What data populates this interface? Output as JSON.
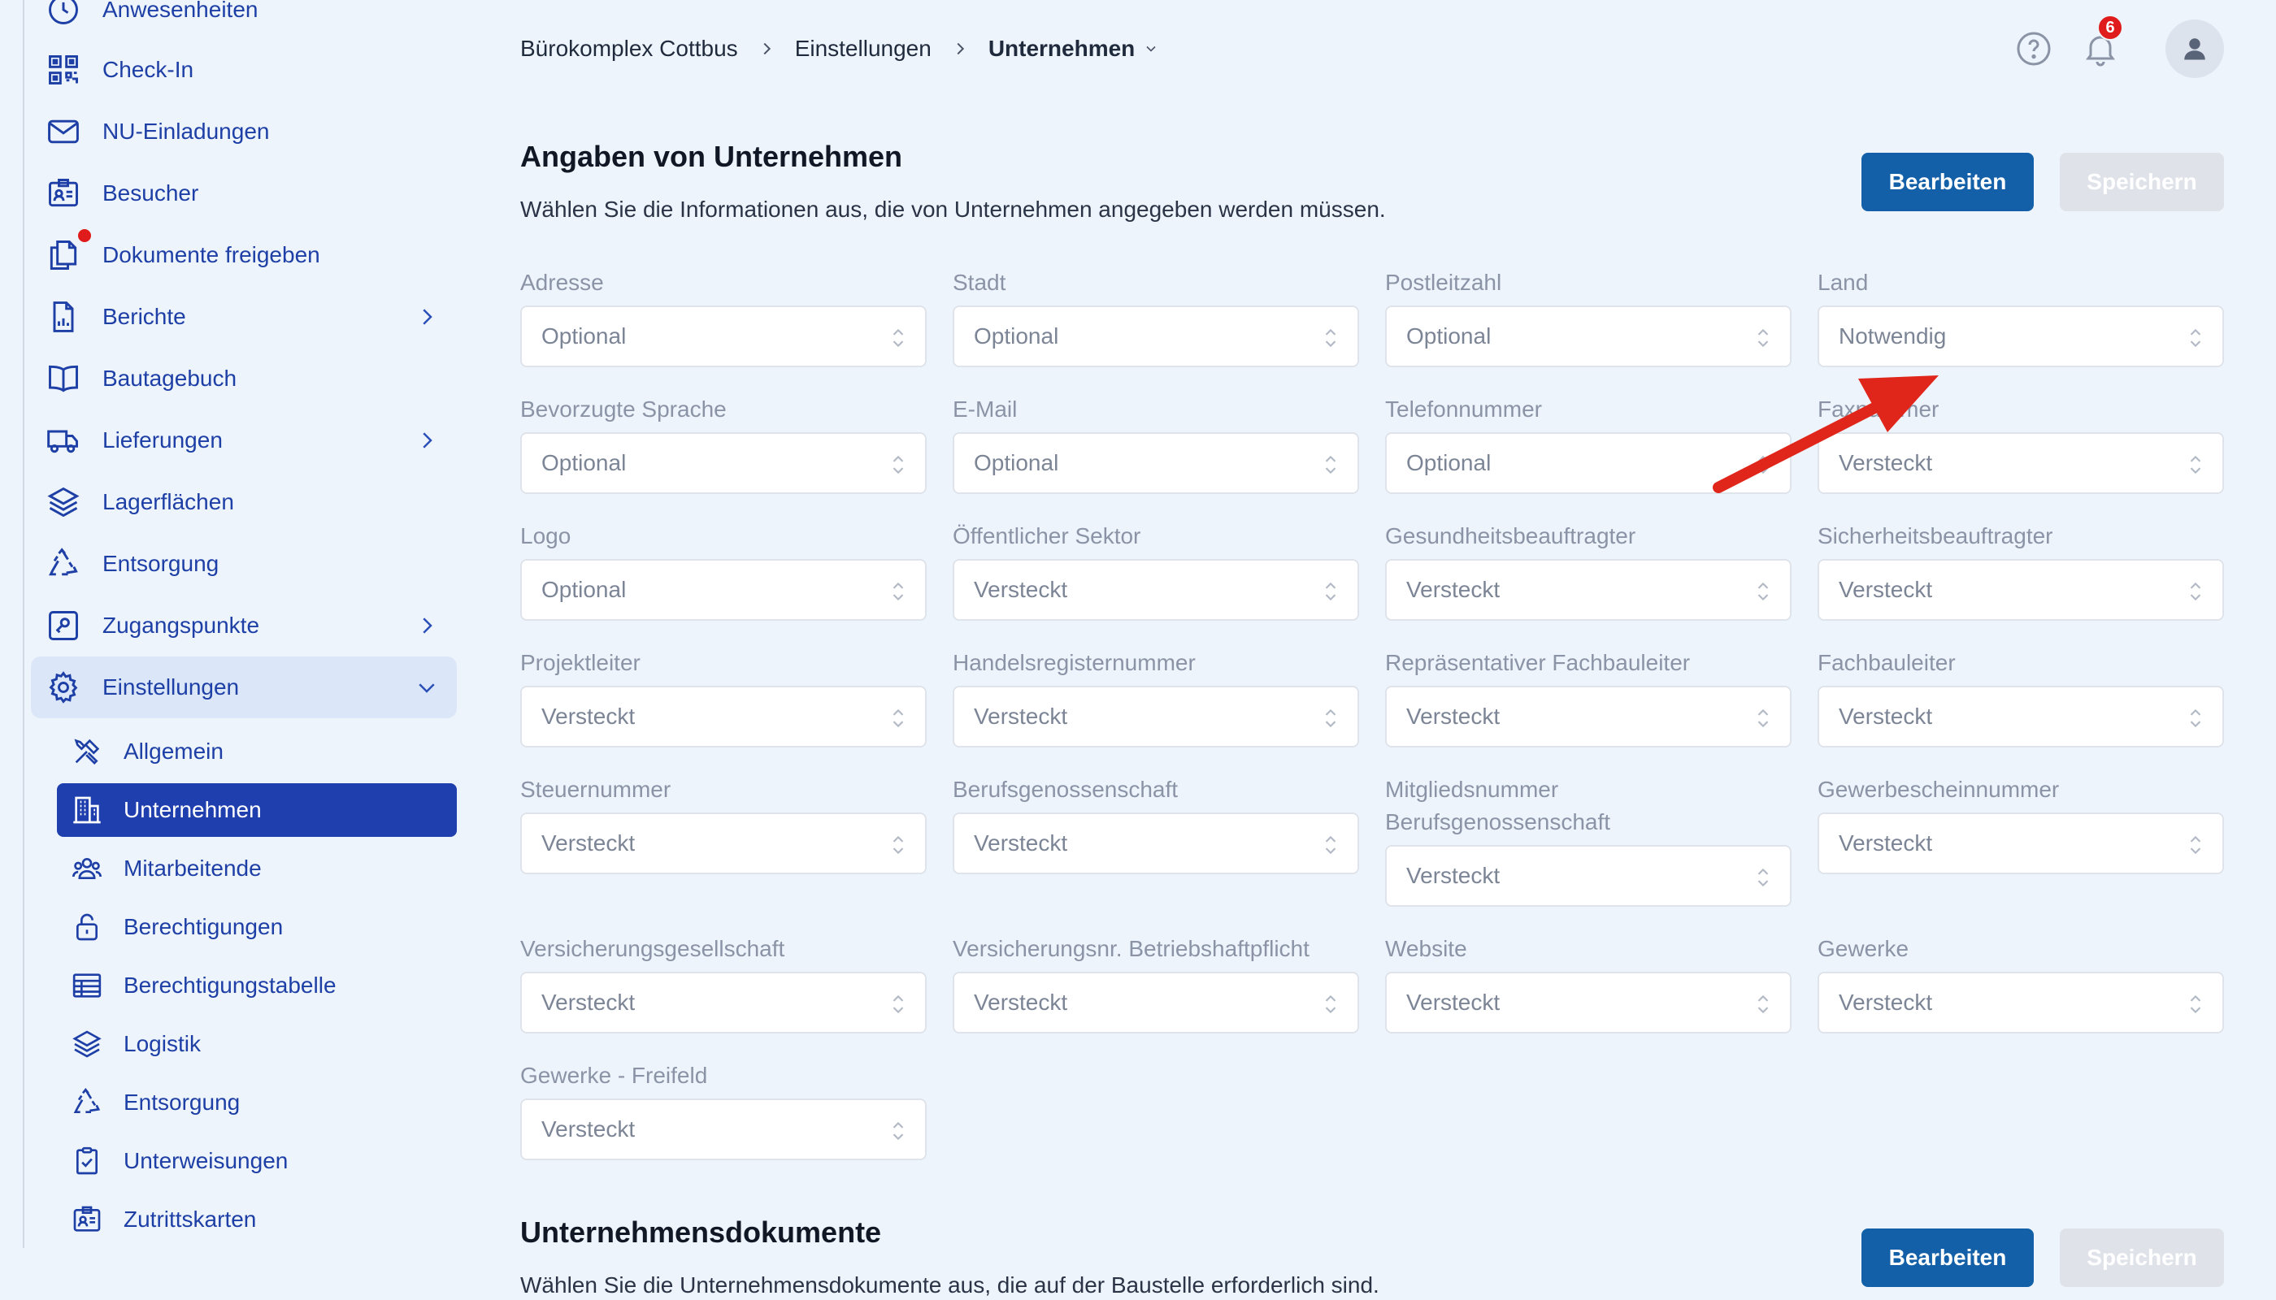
{
  "sidebar": {
    "items": [
      {
        "label": "Anwesenheiten",
        "icon": "clock-icon"
      },
      {
        "label": "Check-In",
        "icon": "qr-code-icon"
      },
      {
        "label": "NU-Einladungen",
        "icon": "envelope-icon"
      },
      {
        "label": "Besucher",
        "icon": "id-badge-icon"
      },
      {
        "label": "Dokumente freigeben",
        "icon": "documents-icon",
        "notification_dot": true
      },
      {
        "label": "Berichte",
        "icon": "report-icon",
        "expandable": true
      },
      {
        "label": "Bautagebuch",
        "icon": "book-icon"
      },
      {
        "label": "Lieferungen",
        "icon": "truck-icon",
        "expandable": true
      },
      {
        "label": "Lagerflächen",
        "icon": "layers-icon"
      },
      {
        "label": "Entsorgung",
        "icon": "recycle-icon"
      },
      {
        "label": "Zugangspunkte",
        "icon": "key-card-icon",
        "expandable": true
      },
      {
        "label": "Einstellungen",
        "icon": "gear-icon",
        "expanded": true
      }
    ],
    "sub_items": [
      {
        "label": "Allgemein",
        "icon": "tools-icon"
      },
      {
        "label": "Unternehmen",
        "icon": "building-icon",
        "selected": true
      },
      {
        "label": "Mitarbeitende",
        "icon": "people-icon"
      },
      {
        "label": "Berechtigungen",
        "icon": "lock-open-icon"
      },
      {
        "label": "Berechtigungstabelle",
        "icon": "table-icon"
      },
      {
        "label": "Logistik",
        "icon": "layers-icon"
      },
      {
        "label": "Entsorgung",
        "icon": "recycle-icon"
      },
      {
        "label": "Unterweisungen",
        "icon": "clipboard-check-icon"
      },
      {
        "label": "Zutrittskarten",
        "icon": "id-badge-icon"
      }
    ]
  },
  "header": {
    "breadcrumb": [
      "Bürokomplex Cottbus",
      "Einstellungen",
      "Unternehmen"
    ],
    "notification_count": "6"
  },
  "section1": {
    "title": "Angaben von Unternehmen",
    "description": "Wählen Sie die Informationen aus, die von Unternehmen angegeben werden müssen.",
    "edit_label": "Bearbeiten",
    "save_label": "Speichern",
    "fields": [
      {
        "label": "Adresse",
        "value": "Optional"
      },
      {
        "label": "Stadt",
        "value": "Optional"
      },
      {
        "label": "Postleitzahl",
        "value": "Optional"
      },
      {
        "label": "Land",
        "value": "Notwendig"
      },
      {
        "label": "Bevorzugte Sprache",
        "value": "Optional"
      },
      {
        "label": "E-Mail",
        "value": "Optional"
      },
      {
        "label": "Telefonnummer",
        "value": "Optional"
      },
      {
        "label": "Faxnummer",
        "value": "Versteckt"
      },
      {
        "label": "Logo",
        "value": "Optional"
      },
      {
        "label": "Öffentlicher Sektor",
        "value": "Versteckt"
      },
      {
        "label": "Gesundheitsbeauftragter",
        "value": "Versteckt"
      },
      {
        "label": "Sicherheitsbeauftragter",
        "value": "Versteckt"
      },
      {
        "label": "Projektleiter",
        "value": "Versteckt"
      },
      {
        "label": "Handelsregisternummer",
        "value": "Versteckt"
      },
      {
        "label": "Repräsentativer Fachbauleiter",
        "value": "Versteckt"
      },
      {
        "label": "Fachbauleiter",
        "value": "Versteckt"
      },
      {
        "label": "Steuernummer",
        "value": "Versteckt"
      },
      {
        "label": "Berufsgenossenschaft",
        "value": "Versteckt"
      },
      {
        "label": "Mitgliedsnummer Berufsgenossenschaft",
        "value": "Versteckt"
      },
      {
        "label": "Gewerbescheinnummer",
        "value": "Versteckt"
      },
      {
        "label": "Versicherungsgesellschaft",
        "value": "Versteckt"
      },
      {
        "label": "Versicherungsnr. Betriebshaftpflicht",
        "value": "Versteckt"
      },
      {
        "label": "Website",
        "value": "Versteckt"
      },
      {
        "label": "Gewerke",
        "value": "Versteckt"
      },
      {
        "label": "Gewerke - Freifeld",
        "value": "Versteckt"
      }
    ]
  },
  "section2": {
    "title": "Unternehmensdokumente",
    "description": "Wählen Sie die Unternehmensdokumente aus, die auf der Baustelle erforderlich sind.",
    "edit_label": "Bearbeiten",
    "save_label": "Speichern"
  },
  "colors": {
    "accent": "#1d3fa6",
    "primary_button": "#1360a8",
    "annotation_arrow": "#e0261b",
    "badge": "#e01b1b"
  }
}
